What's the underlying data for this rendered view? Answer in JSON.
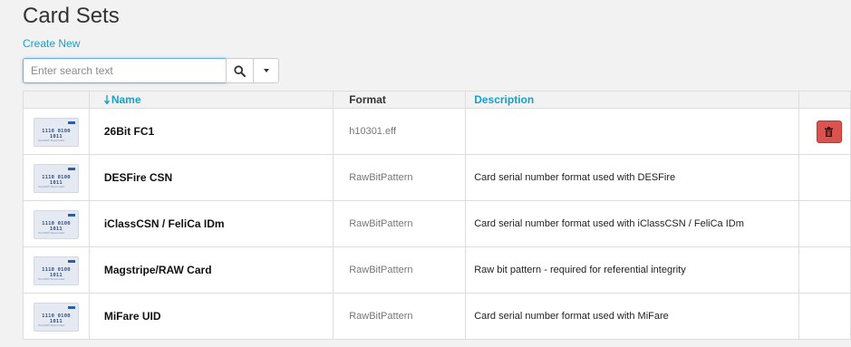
{
  "page": {
    "title": "Card Sets",
    "create_new": "Create New"
  },
  "search": {
    "placeholder": "Enter search text",
    "value": ""
  },
  "icons": {
    "search": "search-icon",
    "dropdown": "caret-down-icon",
    "sort": "sort-down-arrow-icon",
    "delete": "trash-icon",
    "card": "card-thumbnail-icon"
  },
  "colors": {
    "accent": "#1a9fc9",
    "danger": "#d9534f"
  },
  "table": {
    "headers": {
      "name": "Name",
      "format": "Format",
      "description": "Description"
    },
    "card_text": {
      "digits": "1110 0100 1011",
      "small": "ICLASS® Smart Card"
    },
    "rows": [
      {
        "name": "26Bit FC1",
        "format": "h10301.eff",
        "description": "",
        "has_delete": true
      },
      {
        "name": "DESFire CSN",
        "format": "RawBitPattern",
        "description": "Card serial number format used with DESFire",
        "has_delete": false
      },
      {
        "name": "iClassCSN / FeliCa IDm",
        "format": "RawBitPattern",
        "description": "Card serial number format used with iClassCSN / FeliCa IDm",
        "has_delete": false
      },
      {
        "name": "Magstripe/RAW Card",
        "format": "RawBitPattern",
        "description": "Raw bit pattern - required for referential integrity",
        "has_delete": false
      },
      {
        "name": "MiFare UID",
        "format": "RawBitPattern",
        "description": "Card serial number format used with MiFare",
        "has_delete": false
      }
    ]
  }
}
